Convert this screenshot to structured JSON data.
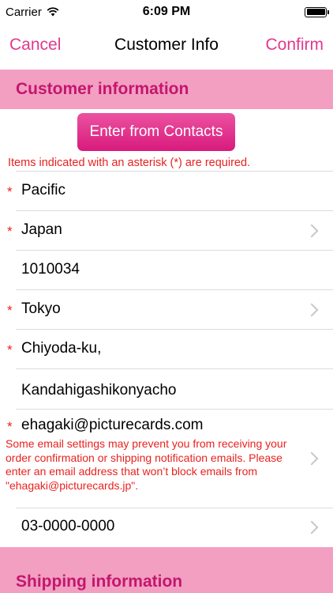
{
  "status_bar": {
    "carrier": "Carrier",
    "time": "6:09 PM",
    "wifi_icon": "wifi-icon",
    "battery_icon": "battery-icon"
  },
  "nav": {
    "cancel_label": "Cancel",
    "title": "Customer Info",
    "confirm_label": "Confirm"
  },
  "customer_section": {
    "title": "Customer information",
    "contacts_button_label": "Enter from Contacts",
    "required_note": "Items indicated with an asterisk (*) are required.",
    "fields": [
      {
        "value": "Pacific",
        "required": "*"
      },
      {
        "value": "Japan",
        "required": "*"
      },
      {
        "value": "1010034"
      },
      {
        "value": "Tokyo",
        "required": "*"
      },
      {
        "value": "Chiyoda-ku,",
        "required": "*"
      },
      {
        "value": "Kandahigashikonyacho"
      },
      {
        "value": "ehagaki@picturecards.com",
        "required": "*"
      },
      {
        "value": "03-0000-0000"
      }
    ],
    "email_note": "Some email settings may prevent you from receiving your order confirmation or shipping notification emails. Please enter an email address that won’t block emails from \"ehagaki@picturecards.jp\"."
  },
  "shipping_section": {
    "title": "Shipping information"
  },
  "colors": {
    "accent": "#e0398f",
    "section_bg": "#f29fc2",
    "section_text": "#c4166d",
    "required_red": "#e8221f"
  }
}
